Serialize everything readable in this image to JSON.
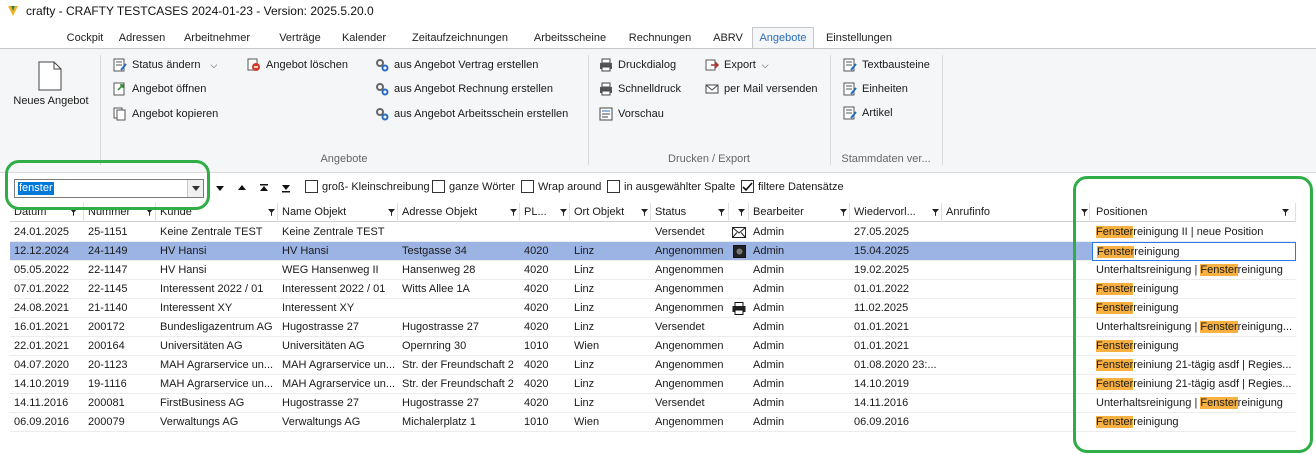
{
  "window": {
    "title": "crafty - CRAFTY TESTCASES 2024-01-23 - Version: 2025.5.20.0"
  },
  "menu": {
    "tabs": [
      {
        "label": "Cockpit"
      },
      {
        "label": "Adressen"
      },
      {
        "label": "Arbeitnehmer"
      },
      {
        "label": "Verträge"
      },
      {
        "label": "Kalender"
      },
      {
        "label": "Zeitaufzeichnungen"
      },
      {
        "label": "Arbeitsscheine"
      },
      {
        "label": "Rechnungen"
      },
      {
        "label": "ABRV"
      },
      {
        "label": "Angebote"
      },
      {
        "label": "Einstellungen"
      }
    ],
    "active": "Angebote"
  },
  "ribbon": {
    "new_offer": "Neues Angebot",
    "status_change": "Status ändern",
    "open_offer": "Angebot öffnen",
    "copy_offer": "Angebot kopieren",
    "delete_offer": "Angebot löschen",
    "from_contract": "aus Angebot Vertrag erstellen",
    "from_invoice": "aus Angebot Rechnung erstellen",
    "from_worksheet": "aus Angebot Arbeitsschein erstellen",
    "print_dialog": "Druckdialog",
    "quick_print": "Schnelldruck",
    "preview": "Vorschau",
    "export": "Export",
    "send_mail": "per Mail versenden",
    "text_blocks": "Textbausteine",
    "units": "Einheiten",
    "articles": "Artikel",
    "group_offers": "Angebote",
    "group_print": "Drucken / Export",
    "group_master": "Stammdaten ver..."
  },
  "search": {
    "value": "fenster",
    "case_sensitive": "groß- Kleinschreibung",
    "whole_words": "ganze Wörter",
    "wrap_around": "Wrap around",
    "selected_column": "in ausgewählter Spalte",
    "filtered_records": "filtere Datensätze",
    "filtered_checked": true
  },
  "table": {
    "columns": [
      "Datum",
      "Nummer",
      "Kunde",
      "Name Objekt",
      "Adresse Objekt",
      "PL...",
      "Ort Objekt",
      "Status",
      "",
      "Bearbeiter",
      "Wiedervorl...",
      "Anrufinfo",
      "Positionen"
    ],
    "rows": [
      {
        "datum": "24.01.2025",
        "nummer": "25-1151",
        "kunde": "Keine Zentrale TEST",
        "name": "Keine Zentrale TEST",
        "adresse": "",
        "plz": "",
        "ort": "",
        "status": "Versendet",
        "icon": "mail-icon",
        "bearbeiter": "Admin",
        "wv": "27.05.2025",
        "anruf": "",
        "pos_hl": "Fenster",
        "pos_rest": "reinigung II | neue Position",
        "pos_pre": "",
        "pos_hl2": "",
        "pos_rest2": ""
      },
      {
        "datum": "12.12.2024",
        "nummer": "24-1149",
        "kunde": "HV Hansi",
        "name": "HV Hansi",
        "adresse": "Testgasse 34",
        "plz": "4020",
        "ort": "Linz",
        "status": "Angenommen",
        "icon": "app-icon",
        "bearbeiter": "Admin",
        "wv": "15.04.2025",
        "anruf": "",
        "pos_hl": "Fenster",
        "pos_rest": "reinigung",
        "pos_pre": "",
        "pos_hl2": "",
        "pos_rest2": ""
      },
      {
        "datum": "05.05.2022",
        "nummer": "22-1147",
        "kunde": "HV Hansi",
        "name": "WEG Hansenweg II",
        "adresse": "Hansenweg 28",
        "plz": "4020",
        "ort": "Linz",
        "status": "Angenommen",
        "icon": "",
        "bearbeiter": "Admin",
        "wv": "19.02.2025",
        "anruf": "",
        "pos_pre": "Unterhaltsreinigung | ",
        "pos_hl": "",
        "pos_rest": "",
        "pos_hl2": "Fenster",
        "pos_rest2": "reinigung"
      },
      {
        "datum": "07.01.2022",
        "nummer": "22-1145",
        "kunde": "Interessent 2022 / 01",
        "name": "Interessent 2022 / 01",
        "adresse": "Witts Allee 1A",
        "plz": "4020",
        "ort": "Linz",
        "status": "Angenommen",
        "icon": "",
        "bearbeiter": "Admin",
        "wv": "01.01.2022",
        "anruf": "",
        "pos_hl": "Fenster",
        "pos_rest": "reinigung",
        "pos_pre": "",
        "pos_hl2": "",
        "pos_rest2": ""
      },
      {
        "datum": "24.08.2021",
        "nummer": "21-1140",
        "kunde": "Interessent XY",
        "name": "Interessent XY",
        "adresse": "",
        "plz": "4020",
        "ort": "Linz",
        "status": "Angenommen",
        "icon": "print-icon",
        "bearbeiter": "Admin",
        "wv": "11.02.2025",
        "anruf": "",
        "pos_hl": "Fenster",
        "pos_rest": "reinigung",
        "pos_pre": "",
        "pos_hl2": "",
        "pos_rest2": ""
      },
      {
        "datum": "16.01.2021",
        "nummer": "200172",
        "kunde": "Bundesligazentrum AG",
        "name": "Hugostrasse 27",
        "adresse": "Hugostrasse 27",
        "plz": "4020",
        "ort": "Linz",
        "status": "Versendet",
        "icon": "",
        "bearbeiter": "Admin",
        "wv": "01.01.2021",
        "anruf": "",
        "pos_pre": "Unterhaltsreinigung | ",
        "pos_hl": "",
        "pos_rest": "",
        "pos_hl2": "Fenster",
        "pos_rest2": "reinigung..."
      },
      {
        "datum": "22.01.2021",
        "nummer": "200164",
        "kunde": "Universitäten AG",
        "name": "Universitäten AG",
        "adresse": "Opernring 30",
        "plz": "1010",
        "ort": "Wien",
        "status": "Angenommen",
        "icon": "",
        "bearbeiter": "Admin",
        "wv": "01.01.2021",
        "anruf": "",
        "pos_hl": "Fenster",
        "pos_rest": "reinigung",
        "pos_pre": "",
        "pos_hl2": "",
        "pos_rest2": ""
      },
      {
        "datum": "04.07.2020",
        "nummer": "20-1123",
        "kunde": "MAH Agrarservice un...",
        "name": "MAH Agrarservice un...",
        "adresse": "Str. der Freundschaft 2",
        "plz": "4020",
        "ort": "Linz",
        "status": "Angenommen",
        "icon": "",
        "bearbeiter": "Admin",
        "wv": "01.08.2020 23:...",
        "anruf": "",
        "pos_hl": "Fenster",
        "pos_rest": "reiniung 21-tägig asdf | Regies...",
        "pos_pre": "",
        "pos_hl2": "",
        "pos_rest2": ""
      },
      {
        "datum": "14.10.2019",
        "nummer": "19-1116",
        "kunde": "MAH Agrarservice un...",
        "name": "MAH Agrarservice un...",
        "adresse": "Str. der Freundschaft 2",
        "plz": "4020",
        "ort": "Linz",
        "status": "Angenommen",
        "icon": "",
        "bearbeiter": "Admin",
        "wv": "14.10.2019",
        "anruf": "",
        "pos_hl": "Fenster",
        "pos_rest": "reiniung 21-tägig asdf | Regies...",
        "pos_pre": "",
        "pos_hl2": "",
        "pos_rest2": ""
      },
      {
        "datum": "14.11.2016",
        "nummer": "200081",
        "kunde": "FirstBusiness AG",
        "name": "Hugostrasse 27",
        "adresse": "Hugostrasse 27",
        "plz": "4020",
        "ort": "Linz",
        "status": "Versendet",
        "icon": "",
        "bearbeiter": "Admin",
        "wv": "14.11.2016",
        "anruf": "",
        "pos_pre": "Unterhaltsreinigung | ",
        "pos_hl": "",
        "pos_rest": "",
        "pos_hl2": "Fenster",
        "pos_rest2": "reinigung"
      },
      {
        "datum": "06.09.2016",
        "nummer": "200079",
        "kunde": "Verwaltungs AG",
        "name": "Verwaltungs AG",
        "adresse": "Michalerplatz 1",
        "plz": "1010",
        "ort": "Wien",
        "status": "Angenommen",
        "icon": "",
        "bearbeiter": "Admin",
        "wv": "06.09.2016",
        "anruf": "",
        "pos_hl": "Fenster",
        "pos_rest": "reinigung",
        "pos_pre": "",
        "pos_hl2": "",
        "pos_rest2": ""
      }
    ],
    "selected_index": 1
  },
  "colors": {
    "accent": "#2a6ebb",
    "selection": "#9cb4e4",
    "match": "#f8b040",
    "outline": "#2fae47"
  }
}
